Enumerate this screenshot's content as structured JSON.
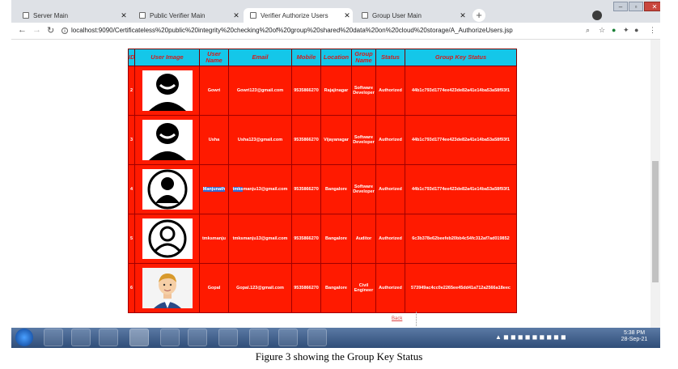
{
  "browser": {
    "tabs": [
      {
        "title": "Server Main"
      },
      {
        "title": "Public Verifier Main"
      },
      {
        "title": "Verifier Authorize Users"
      },
      {
        "title": "Group User Main"
      }
    ],
    "new_tab": "+",
    "url": "localhost:9090/Certificateless%20public%20integrity%20checking%20of%20group%20shared%20data%20on%20cloud%20storage/A_AuthorizeUsers.jsp"
  },
  "table": {
    "headers": {
      "id": "ID",
      "image": "User Image",
      "name": "User Name",
      "email": "Email",
      "mobile": "Mobile",
      "location": "Location",
      "group": "Group Name",
      "status": "Status",
      "key": "Group Key Status"
    },
    "rows": [
      {
        "id": "2",
        "name": "Gowri",
        "email": "Gowri123@gmail.com",
        "mobile": "9535866270",
        "location": "Rajajinagar",
        "group": "Software Developer",
        "status": "Authorized",
        "key": "44b1c793d1774ee423de82a41e14ba53a58f93f1"
      },
      {
        "id": "3",
        "name": "Usha",
        "email": "Usha123@gmail.com",
        "mobile": "9535866270",
        "location": "Vijayanagar",
        "group": "Software Developer",
        "status": "Authorized",
        "key": "44b1c793d1774ee423de82a41e14ba53a58f93f1"
      },
      {
        "id": "4",
        "name_a": "Manjunath",
        "name_b": " tmks",
        "email": "manju13@gmail.com",
        "mobile": "9535866270",
        "location": "Bangalore",
        "group": "Software Developer",
        "status": "Authorized",
        "key": "44b1c793d1774ee423de82a41e14ba53a58f93f1"
      },
      {
        "id": "5",
        "name": "tmksmanju",
        "email": "tmksmanju13@gmail.com",
        "mobile": "9535866270",
        "location": "Bangalore",
        "group": "Auditor",
        "status": "Authorized",
        "key": "6c3b378e62beefeb20bb4c54fc312af7ad019852"
      },
      {
        "id": "6",
        "name": "Gopal",
        "email": "Gopal.123@gmail.com",
        "mobile": "9535866270",
        "location": "Bangalore",
        "group": "Civil Engineer",
        "status": "Authorized",
        "key": "573949ac4cc0e2265ee45dd41a712a2566a18eec"
      }
    ]
  },
  "back_link": "Back",
  "taskbar": {
    "clock_time": "5:38 PM",
    "clock_date": "28-Sep-21"
  },
  "caption": "Figure 3 showing the Group Key Status",
  "colors": {
    "header_bg": "#14c7e9",
    "header_text": "#d31d1d",
    "row_bg": "#ff1a00"
  }
}
